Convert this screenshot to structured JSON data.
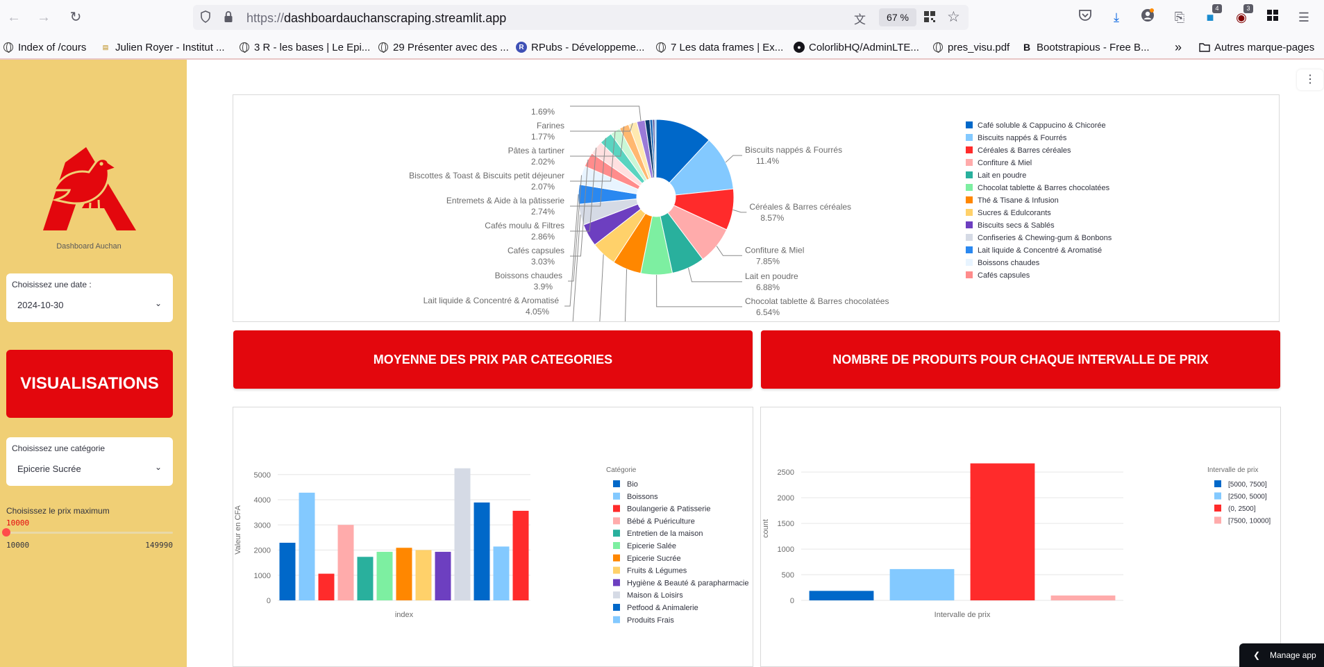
{
  "browser": {
    "url_proto": "https://",
    "url_host": "dashboardauchanscraping.streamlit.app",
    "zoom": "67 %",
    "badge_extensions": "4",
    "badge_ublock": "3",
    "bookmarks": [
      "Index of /cours",
      "Julien Royer - Institut ...",
      "3 R - les bases | Le Epi...",
      "29 Présenter avec des ...",
      "RPubs - Développeme...",
      "7 Les data frames | Ex...",
      "ColorlibHQ/AdminLTE...",
      "pres_visu.pdf",
      "Bootstrapious - Free B..."
    ],
    "other_bookmarks": "Autres marque-pages"
  },
  "sidebar": {
    "logo_caption": "Dashboard Auchan",
    "date_label": "Choisissez une date :",
    "date_value": "2024-10-30",
    "visualisations": "VISUALISATIONS",
    "category_label": "Choisissez une catégorie",
    "category_value": "Epicerie Sucrée",
    "slider_label": "Choisissez le prix maximum",
    "slider_value": "10000",
    "slider_min": "10000",
    "slider_max": "149990",
    "slider_fraction": 0
  },
  "colors": {
    "sidebar_bg": "#f0cf75",
    "auchan_red": "#e3070d",
    "slider_red": "#ff4b4b"
  },
  "cards": {
    "avg_price": "MOYENNE DES PRIX PAR CATEGORIES",
    "price_intervals": "NOMBRE DE PRODUITS POUR CHAQUE INTERVALLE DE PRIX"
  },
  "manage_app": "Manage app",
  "chart_data": [
    {
      "type": "pie",
      "hole": 0.25,
      "slices": [
        {
          "label": "Café soluble & Cappucino & Chicorée",
          "value": 11.9,
          "color": "#0068c9"
        },
        {
          "label": "Biscuits nappés & Fourrés",
          "value": 11.4,
          "color": "#83c9ff",
          "pct": "11.4%"
        },
        {
          "label": "Céréales & Barres céréales",
          "value": 8.57,
          "color": "#ff2b2b",
          "pct": "8.57%"
        },
        {
          "label": "Confiture & Miel",
          "value": 7.85,
          "color": "#ffabab",
          "pct": "7.85%"
        },
        {
          "label": "Lait en poudre",
          "value": 6.88,
          "color": "#29b09d",
          "pct": "6.88%"
        },
        {
          "label": "Chocolat tablette & Barres chocolatées",
          "value": 6.54,
          "color": "#7defa1",
          "pct": "6.54%"
        },
        {
          "label": "Thé & Tisane & Infusion",
          "value": 5.99,
          "color": "#ff8700",
          "pct": "5.99%"
        },
        {
          "label": "Sucres & Edulcorants",
          "value": 5.3,
          "color": "#ffd16a",
          "pct": "5.3%"
        },
        {
          "label": "Biscuits secs & Sablés",
          "value": 4.7,
          "color": "#6d3fc0"
        },
        {
          "label": "Confiseries & Chewing-gum & Bonbons",
          "value": 4.36,
          "color": "#d5dae5",
          "pct": "4.36%"
        },
        {
          "label": "Lait liquide & Concentré & Aromatisé",
          "value": 4.05,
          "color": "#2a88f0",
          "pct": "4.05%"
        },
        {
          "label": "Boissons chaudes",
          "value": 3.9,
          "color": "#e8f4ff",
          "pct": "3.9%"
        },
        {
          "label": "Cafés capsules",
          "value": 3.03,
          "color": "#ff8c8c",
          "pct": "3.03%"
        },
        {
          "label": "Cafés moulu & Filtres",
          "value": 2.86,
          "color": "#ffe0e0",
          "pct": "2.86%"
        },
        {
          "label": "Entremets & Aide à la pâtisserie",
          "value": 2.74,
          "color": "#5ad4c0",
          "pct": "2.74%"
        },
        {
          "label": "Biscottes & Toast & Biscuits petit déjeuner",
          "value": 2.07,
          "color": "#c9f7d6",
          "pct": "2.07%"
        },
        {
          "label": "Pâtes à tartiner",
          "value": 2.02,
          "color": "#ffb870",
          "pct": "2.02%"
        },
        {
          "label": "Farines",
          "value": 1.77,
          "color": "#ffe9b0",
          "pct": "1.77%"
        },
        {
          "label": "",
          "value": 1.69,
          "color": "#9a7ad8",
          "pct": "1.69%"
        },
        {
          "label": "",
          "value": 1.0,
          "color": "#0b3a6e"
        },
        {
          "label": "",
          "value": 0.6,
          "color": "#1f6bb8"
        },
        {
          "label": "",
          "value": 0.4,
          "color": "#3b3b8a"
        },
        {
          "label": "",
          "value": 0.3,
          "color": "#6db6ff"
        }
      ],
      "legend_entries": [
        "Café soluble & Cappucino & Chicorée",
        "Biscuits nappés & Fourrés",
        "Céréales & Barres céréales",
        "Confiture & Miel",
        "Lait en poudre",
        "Chocolat tablette & Barres chocolatées",
        "Thé & Tisane & Infusion",
        "Sucres & Edulcorants",
        "Biscuits secs & Sablés",
        "Confiseries & Chewing-gum & Bonbons",
        "Lait liquide & Concentré & Aromatisé",
        "Boissons chaudes",
        "Cafés capsules"
      ],
      "legend_placement": "right"
    },
    {
      "type": "bar",
      "xlabel": "index",
      "ylabel": "Valeur en CFA",
      "legend_title": "Catégorie",
      "ylim": [
        0,
        5600
      ],
      "yticks": [
        0,
        1000,
        2000,
        3000,
        4000,
        5000
      ],
      "grid": true,
      "categories": [
        "Bio",
        "Boissons",
        "Boulangerie & Patisserie",
        "Bébé & Puériculture",
        "Entretien de la maison",
        "Epicerie Salée",
        "Epicerie Sucrée",
        "Fruits & Légumes",
        "Hygiène & Beauté & parapharmacie",
        "Maison & Loisirs",
        "Petfood & Animalerie",
        "Produits Frais",
        ""
      ],
      "legend_entries": [
        "Bio",
        "Boissons",
        "Boulangerie & Patisserie",
        "Bébé & Puériculture",
        "Entretien de la maison",
        "Epicerie Salée",
        "Epicerie Sucrée",
        "Fruits & Légumes",
        "Hygiène & Beauté & parapharmacie",
        "Maison & Loisirs",
        "Petfood & Animalerie",
        "Produits Frais"
      ],
      "values": [
        2290,
        4280,
        1060,
        3000,
        1730,
        1930,
        2090,
        2000,
        1930,
        5250,
        3890,
        2140,
        3560
      ],
      "colors": [
        "#0068c9",
        "#83c9ff",
        "#ff2b2b",
        "#ffabab",
        "#29b09d",
        "#7defa1",
        "#ff8700",
        "#ffd16a",
        "#6d3fc0",
        "#d5dae5",
        "#0068c9",
        "#83c9ff",
        "#ff2b2b"
      ]
    },
    {
      "type": "bar",
      "xlabel": "Intervalle de prix",
      "ylabel": "count",
      "legend_title": "Intervalle de prix",
      "ylim": [
        0,
        2800
      ],
      "yticks": [
        0,
        500,
        1000,
        1500,
        2000,
        2500
      ],
      "grid": true,
      "categories": [
        "[5000, 7500]",
        "[2500, 5000]",
        "(0, 2500]",
        "[7500, 10000]"
      ],
      "values": [
        185,
        610,
        2670,
        95
      ],
      "colors": [
        "#0068c9",
        "#83c9ff",
        "#ff2b2b",
        "#ffabab"
      ]
    }
  ]
}
